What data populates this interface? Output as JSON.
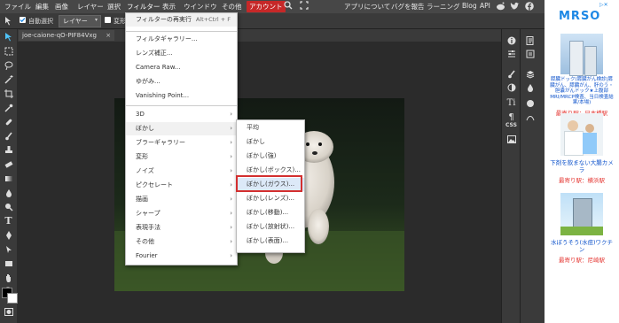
{
  "menubar": {
    "items": [
      "ファイル",
      "編集",
      "画像",
      "レイヤー",
      "選択",
      "フィルター",
      "表示",
      "ウインドウ",
      "その他",
      "アカウント"
    ],
    "right_links": [
      "アプリについて",
      "バグを報告",
      "ラーニング",
      "Blog",
      "API"
    ]
  },
  "options": {
    "auto_select_label": "自動選択",
    "layer_select_value": "レイヤー",
    "transform_label": "変形"
  },
  "document_tab": {
    "name": "joe-caione-qO-PIF84Vxg",
    "close": "×"
  },
  "filter_menu": {
    "items": [
      {
        "label": "フィルターの再実行",
        "shortcut": "Alt+Ctrl + F"
      },
      {
        "label": "フィルタギャラリー..."
      },
      {
        "label": "レンズ補正..."
      },
      {
        "label": "Camera Raw..."
      },
      {
        "label": "ゆがみ..."
      },
      {
        "label": "Vanishing Point..."
      },
      {
        "label": "3D",
        "arrow": "›"
      },
      {
        "label": "ぼかし",
        "arrow": "›"
      },
      {
        "label": "ブラーギャラリー",
        "arrow": "›"
      },
      {
        "label": "変形",
        "arrow": "›"
      },
      {
        "label": "ノイズ",
        "arrow": "›"
      },
      {
        "label": "ピクセレート",
        "arrow": "›"
      },
      {
        "label": "描画",
        "arrow": "›"
      },
      {
        "label": "シャープ",
        "arrow": "›"
      },
      {
        "label": "表現手法",
        "arrow": "›"
      },
      {
        "label": "その他",
        "arrow": "›"
      },
      {
        "label": "Fourier",
        "arrow": "›"
      }
    ]
  },
  "blur_submenu": {
    "items": [
      "平均",
      "ぼかし",
      "ぼかし(強)",
      "ぼかし(ボックス)...",
      "ぼかし(ガウス)...",
      "ぼかし(レンズ)...",
      "ぼかし(移動)...",
      "ぼかし(放射状)...",
      "ぼかし(表面)..."
    ],
    "highlighted_index": 4
  },
  "right_panel": {
    "css_label": "CSS"
  },
  "ad": {
    "logo": "MRSO",
    "cards": [
      {
        "title": "膵臓ドック(膵臓がん検診|膵臓がん、膵臓がん、肝のう・胆嚢がんドック★上腹部MRI/MRCP検査、当日検査結果/本場)",
        "location": "最寄り駅：日本橋駅"
      },
      {
        "title": "下剤を飲まない大腸カメラ",
        "location": "最寄り駅：横浜駅"
      },
      {
        "title": "水ぼうそう(水痘)ワクチン",
        "location": "最寄り駅：尼崎駅"
      }
    ]
  },
  "colors": {
    "accent_red": "#c62828",
    "highlight_border": "#d32f2f",
    "link_blue": "#1155cc"
  }
}
